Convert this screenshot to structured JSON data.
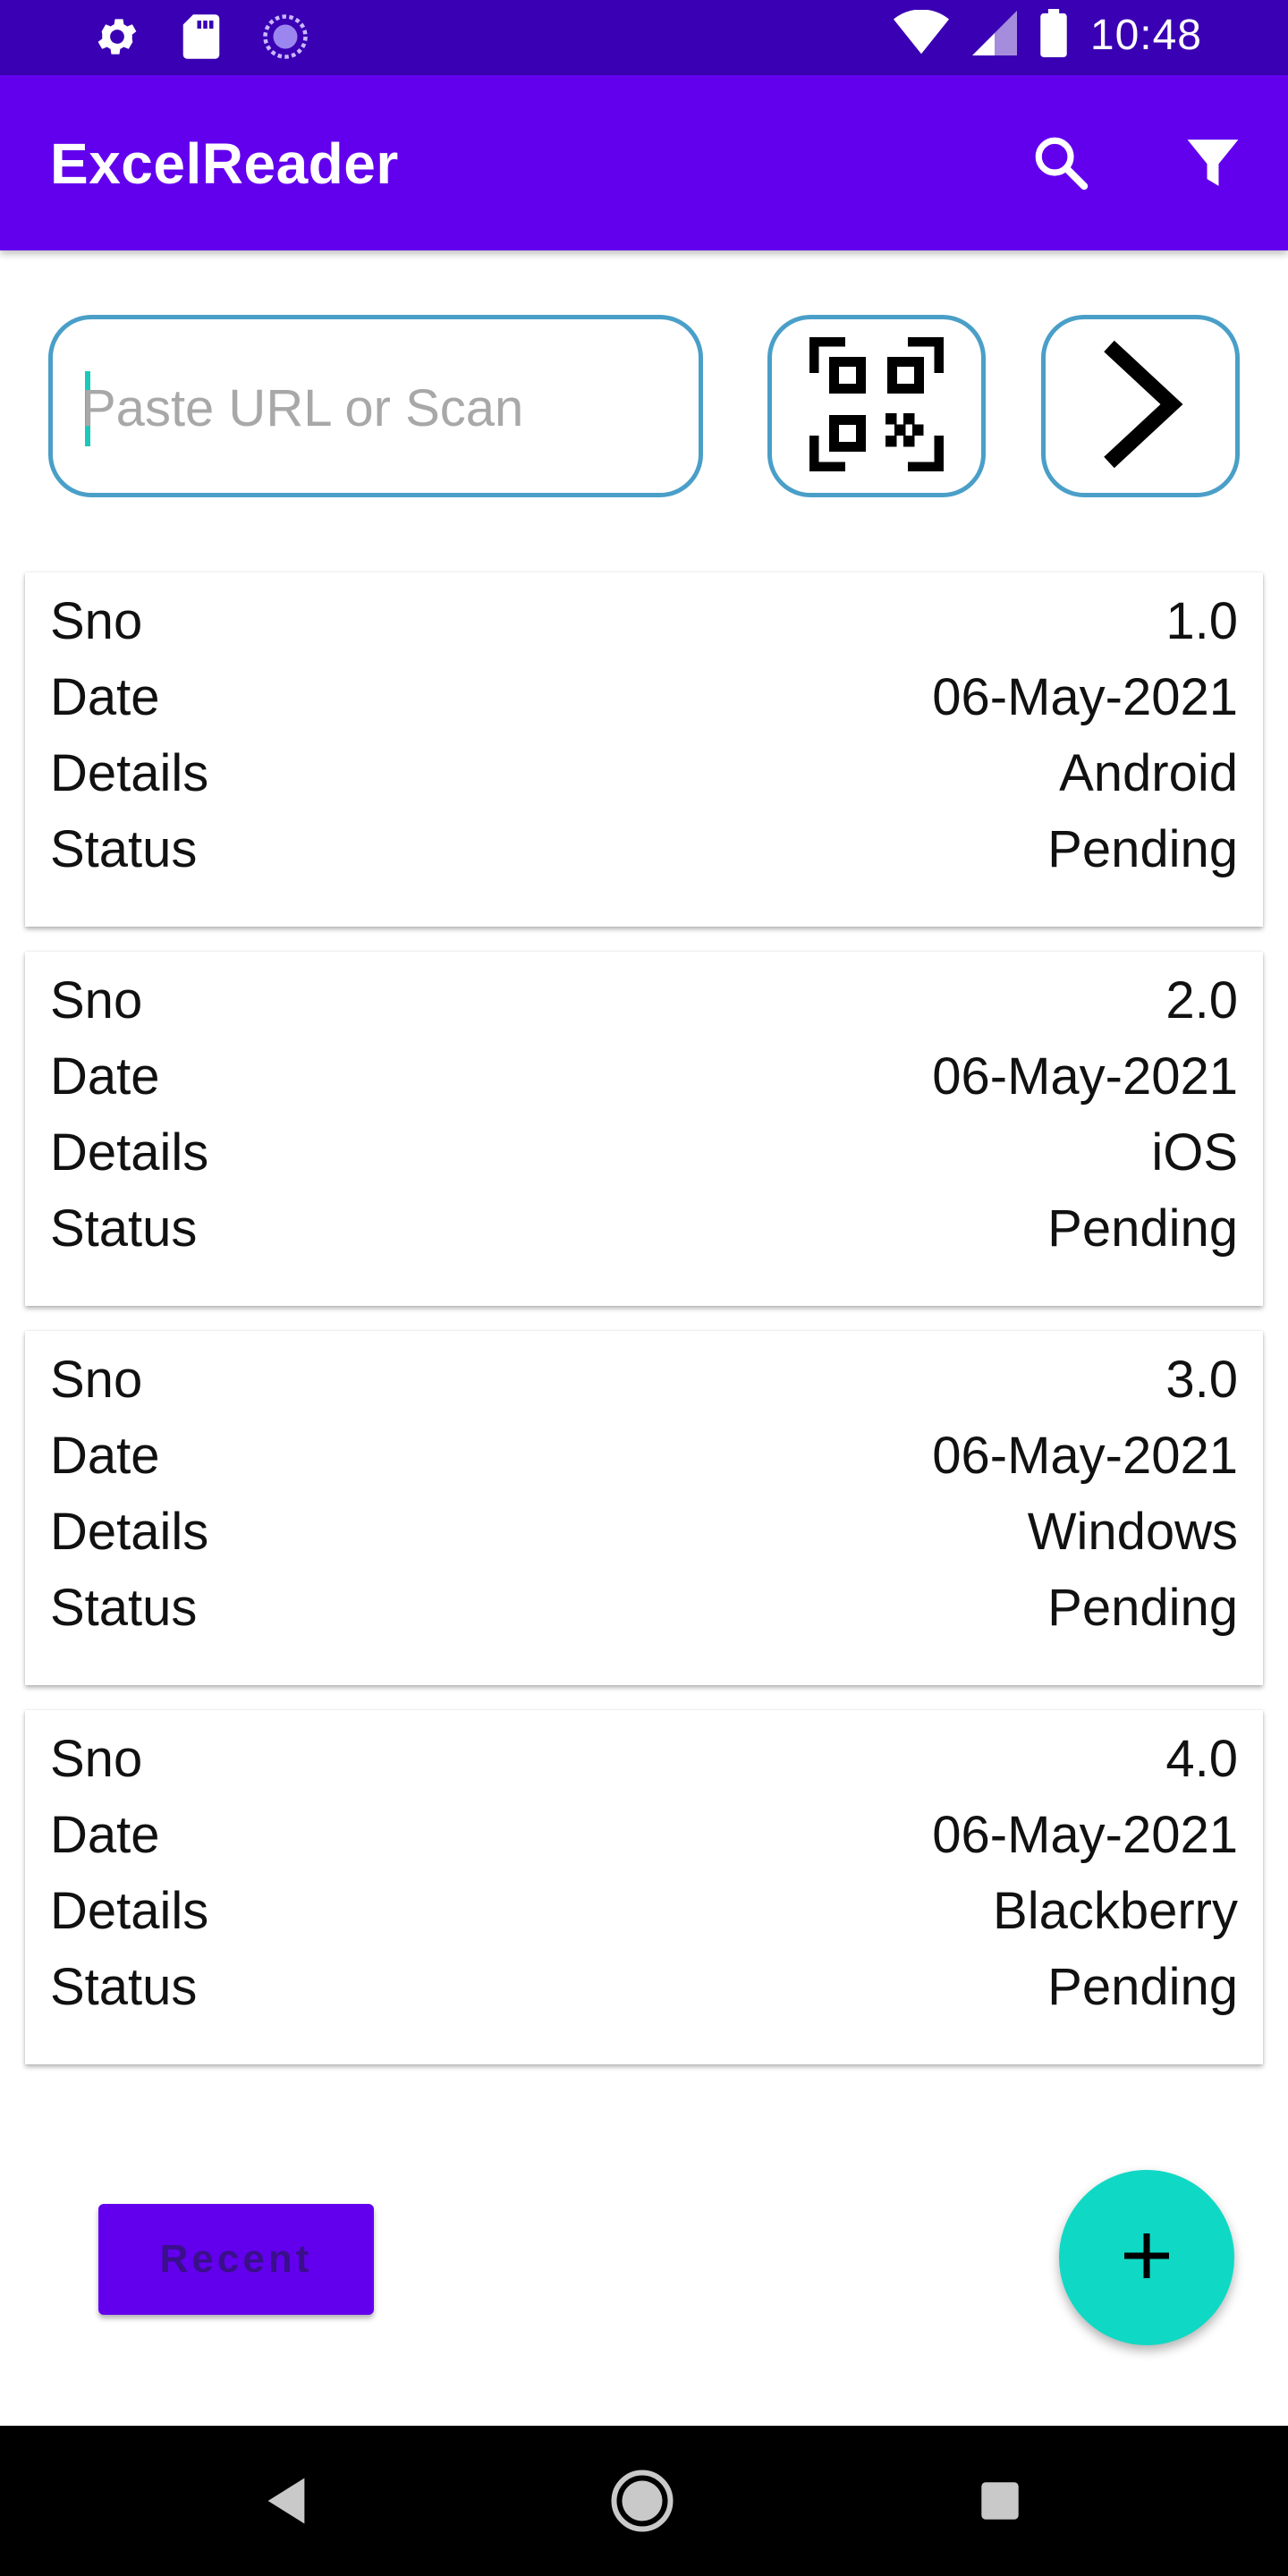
{
  "status_bar": {
    "time": "10:48",
    "left_icons": [
      "settings-icon",
      "sd-card-icon",
      "sync-icon"
    ],
    "right_icons": [
      "wifi-icon",
      "signal-icon",
      "battery-icon"
    ]
  },
  "app_bar": {
    "title": "ExcelReader",
    "actions": [
      "search-icon",
      "filter-icon"
    ]
  },
  "url_input": {
    "value": "",
    "placeholder": "Paste URL or Scan"
  },
  "buttons": {
    "scan": "qr-code-icon",
    "go": "chevron-right-icon",
    "recent": "Recent",
    "fab": "plus-icon"
  },
  "records": [
    {
      "rows": [
        {
          "label": "Sno",
          "value": "1.0"
        },
        {
          "label": "Date",
          "value": "06-May-2021"
        },
        {
          "label": "Details",
          "value": "Android"
        },
        {
          "label": "Status",
          "value": "Pending"
        }
      ]
    },
    {
      "rows": [
        {
          "label": "Sno",
          "value": "2.0"
        },
        {
          "label": "Date",
          "value": "06-May-2021"
        },
        {
          "label": "Details",
          "value": "iOS"
        },
        {
          "label": "Status",
          "value": "Pending"
        }
      ]
    },
    {
      "rows": [
        {
          "label": "Sno",
          "value": "3.0"
        },
        {
          "label": "Date",
          "value": "06-May-2021"
        },
        {
          "label": "Details",
          "value": "Windows"
        },
        {
          "label": "Status",
          "value": "Pending"
        }
      ]
    },
    {
      "rows": [
        {
          "label": "Sno",
          "value": "4.0"
        },
        {
          "label": "Date",
          "value": "06-May-2021"
        },
        {
          "label": "Details",
          "value": "Blackberry"
        },
        {
          "label": "Status",
          "value": "Pending"
        }
      ]
    }
  ],
  "nav_bar": {
    "buttons": [
      "back-icon",
      "home-icon",
      "recents-icon"
    ]
  },
  "colors": {
    "status_bar": "#3a00b3",
    "primary": "#6200ee",
    "input_border": "#4a9fc8",
    "fab": "#0fd9c4"
  }
}
